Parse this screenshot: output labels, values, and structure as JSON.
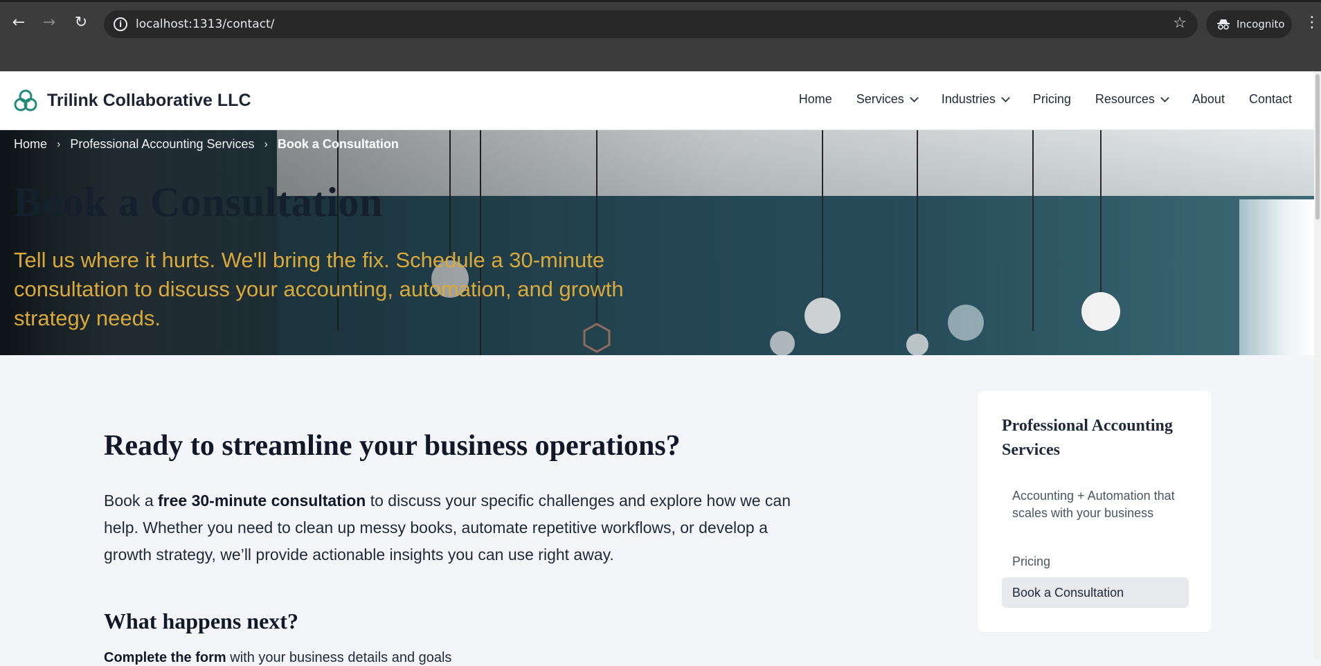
{
  "browser": {
    "url": "localhost:1313/contact/",
    "profile_label": "Incognito",
    "icons": [
      "back-icon",
      "forward-icon",
      "reload-icon",
      "site-info-icon",
      "bookmark-star-icon",
      "incognito-icon",
      "menu-kebab-icon"
    ]
  },
  "header": {
    "brand_name": "Trilink Collaborative LLC",
    "nav": [
      {
        "label": "Home"
      },
      {
        "label": "Services"
      },
      {
        "label": "Industries"
      },
      {
        "label": "Pricing"
      },
      {
        "label": "Resources"
      },
      {
        "label": "About"
      },
      {
        "label": "Contact"
      }
    ],
    "brand_color": "#1f8a7a"
  },
  "hero": {
    "breadcrumb": [
      "Home",
      "Professional Accounting Services",
      "Book a Consultation"
    ],
    "title": "Book a Consultation",
    "subtitle": "Tell us where it hurts. We'll bring the fix. Schedule a 30-minute consultation to discuss your accounting, automation, and growth strategy needs.",
    "subtitle_color": "#d9a93a"
  },
  "main": {
    "heading": "Ready to streamline your business operations?",
    "para_prefix": "Book a ",
    "para_bold": "free 30-minute consultation",
    "para_suffix": " to discuss your specific challenges and explore how we can help. Whether you need to clean up messy books, automate repetitive workflows, or develop a growth strategy, we’ll provide actionable insights you can use right away.",
    "next_heading": "What happens next?",
    "step1_bold": "Complete the form",
    "step1_rest": " with your business details and goals"
  },
  "sidebar": {
    "title": "Professional Accounting Services",
    "links": [
      {
        "label": "Accounting + Automation that scales with your business"
      },
      {
        "label": "Pricing"
      },
      {
        "label": "Book a Consultation"
      }
    ]
  }
}
